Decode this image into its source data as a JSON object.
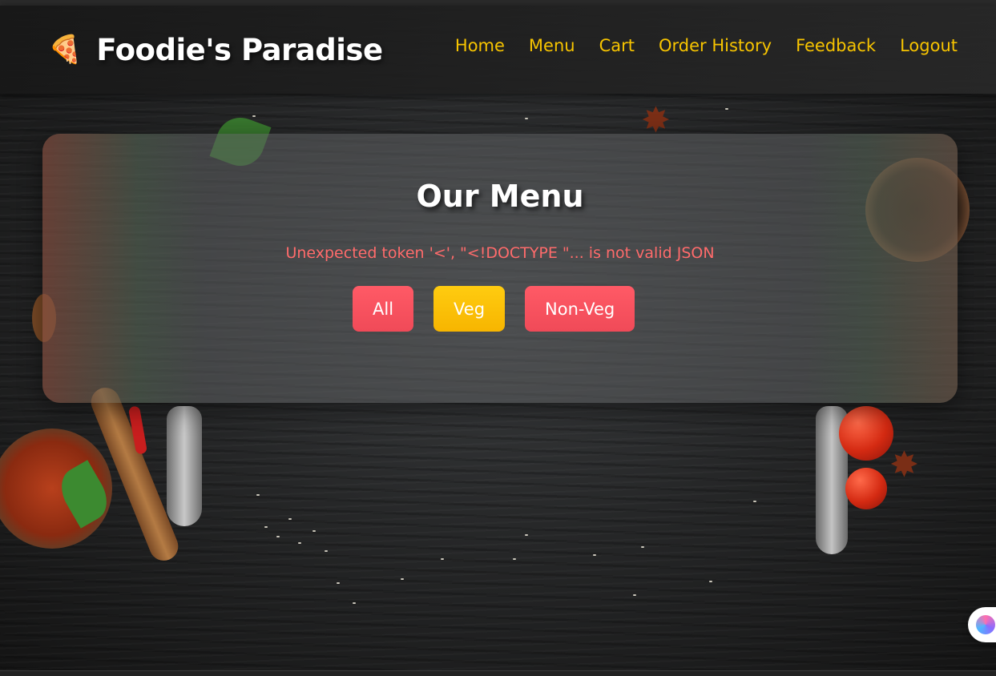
{
  "brand": {
    "icon": "pizza-icon",
    "title": "Foodie's Paradise"
  },
  "nav": {
    "links": [
      "Home",
      "Menu",
      "Cart",
      "Order History",
      "Feedback",
      "Logout"
    ]
  },
  "menu": {
    "title": "Our Menu",
    "error": "Unexpected token '<', \"<!DOCTYPE \"... is not valid JSON",
    "filters": [
      "All",
      "Veg",
      "Non-Veg"
    ],
    "active_filter": "Veg"
  },
  "colors": {
    "nav_link": "#f7c400",
    "error_text": "#ff6b6b",
    "filter_red": "#f04a58",
    "filter_yellow": "#f7b500"
  },
  "assistant": {
    "icon": "brain-icon"
  }
}
